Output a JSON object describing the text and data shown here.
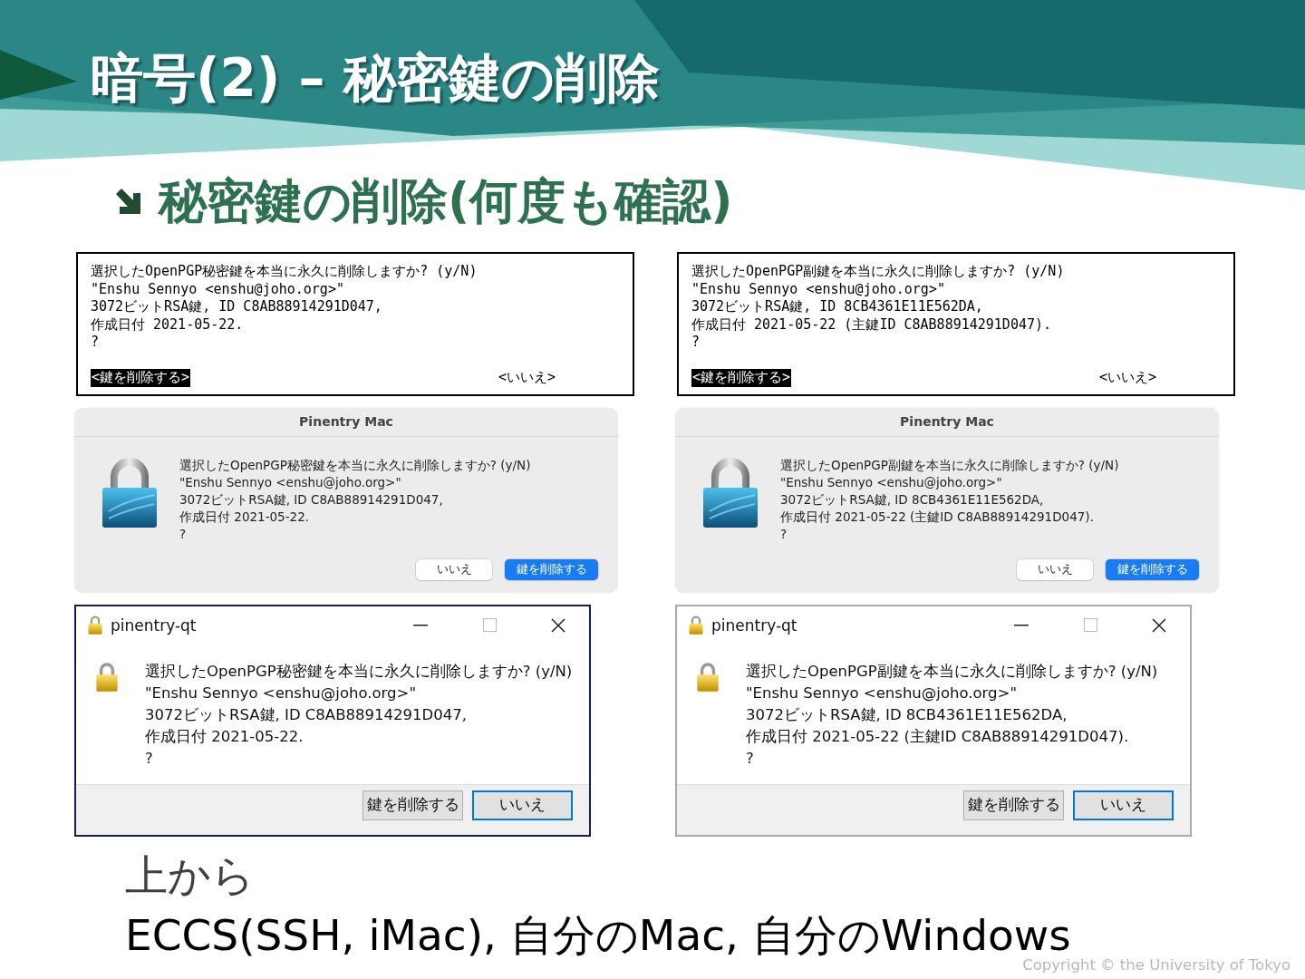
{
  "title": "暗号(2) – 秘密鍵の削除",
  "subtitle": "秘密鍵の削除(何度も確認)",
  "columns": [
    {
      "terminal": {
        "lines": [
          "選択したOpenPGP秘密鍵を本当に永久に削除しますか? (y/N)",
          "\"Enshu Sennyo <enshu@joho.org>\"",
          "3072ビットRSA鍵, ID C8AB88914291D047,",
          "作成日付 2021-05-22.",
          "?"
        ],
        "buttons": [
          {
            "label": "<鍵を削除する>",
            "selected": true
          },
          {
            "label": "<いいえ>",
            "selected": false
          }
        ]
      },
      "mac": {
        "title": "Pinentry Mac",
        "lines": [
          "選択したOpenPGP秘密鍵を本当に永久に削除しますか? (y/N)",
          "\"Enshu Sennyo <enshu@joho.org>\"",
          "3072ビットRSA鍵, ID C8AB88914291D047,",
          "作成日付 2021-05-22.",
          "?"
        ],
        "buttons": [
          {
            "label": "いいえ",
            "default": false
          },
          {
            "label": "鍵を削除する",
            "default": true
          }
        ]
      },
      "windows": {
        "title": "pinentry-qt",
        "active": true,
        "lines": [
          "選択したOpenPGP秘密鍵を本当に永久に削除しますか? (y/N)",
          "\"Enshu Sennyo <enshu@joho.org>\"",
          "3072ビットRSA鍵, ID C8AB88914291D047,",
          "作成日付 2021-05-22.",
          "?"
        ],
        "buttons": [
          {
            "label": "鍵を削除する",
            "default": false
          },
          {
            "label": "いいえ",
            "default": true
          }
        ]
      }
    },
    {
      "terminal": {
        "lines": [
          "選択したOpenPGP副鍵を本当に永久に削除しますか? (y/N)",
          "\"Enshu Sennyo <enshu@joho.org>\"",
          "3072ビットRSA鍵, ID 8CB4361E11E562DA,",
          "作成日付 2021-05-22 (主鍵ID C8AB88914291D047).",
          "?"
        ],
        "buttons": [
          {
            "label": "<鍵を削除する>",
            "selected": true
          },
          {
            "label": "<いいえ>",
            "selected": false
          }
        ]
      },
      "mac": {
        "title": "Pinentry Mac",
        "lines": [
          "選択したOpenPGP副鍵を本当に永久に削除しますか? (y/N)",
          "\"Enshu Sennyo <enshu@joho.org>\"",
          "3072ビットRSA鍵, ID 8CB4361E11E562DA,",
          "作成日付 2021-05-22 (主鍵ID C8AB88914291D047).",
          "?"
        ],
        "buttons": [
          {
            "label": "いいえ",
            "default": false
          },
          {
            "label": "鍵を削除する",
            "default": true
          }
        ]
      },
      "windows": {
        "title": "pinentry-qt",
        "active": false,
        "lines": [
          "選択したOpenPGP副鍵を本当に永久に削除しますか? (y/N)",
          "\"Enshu Sennyo <enshu@joho.org>\"",
          "3072ビットRSA鍵, ID 8CB4361E11E562DA,",
          "作成日付 2021-05-22 (主鍵ID C8AB88914291D047).",
          "?"
        ],
        "buttons": [
          {
            "label": "鍵を削除する",
            "default": false
          },
          {
            "label": "いいえ",
            "default": true
          }
        ]
      }
    }
  ],
  "footer": [
    "上から",
    "ECCS(SSH, iMac), 自分のMac, 自分のWindows"
  ],
  "copyright": "Copyright © the University of Tokyo"
}
